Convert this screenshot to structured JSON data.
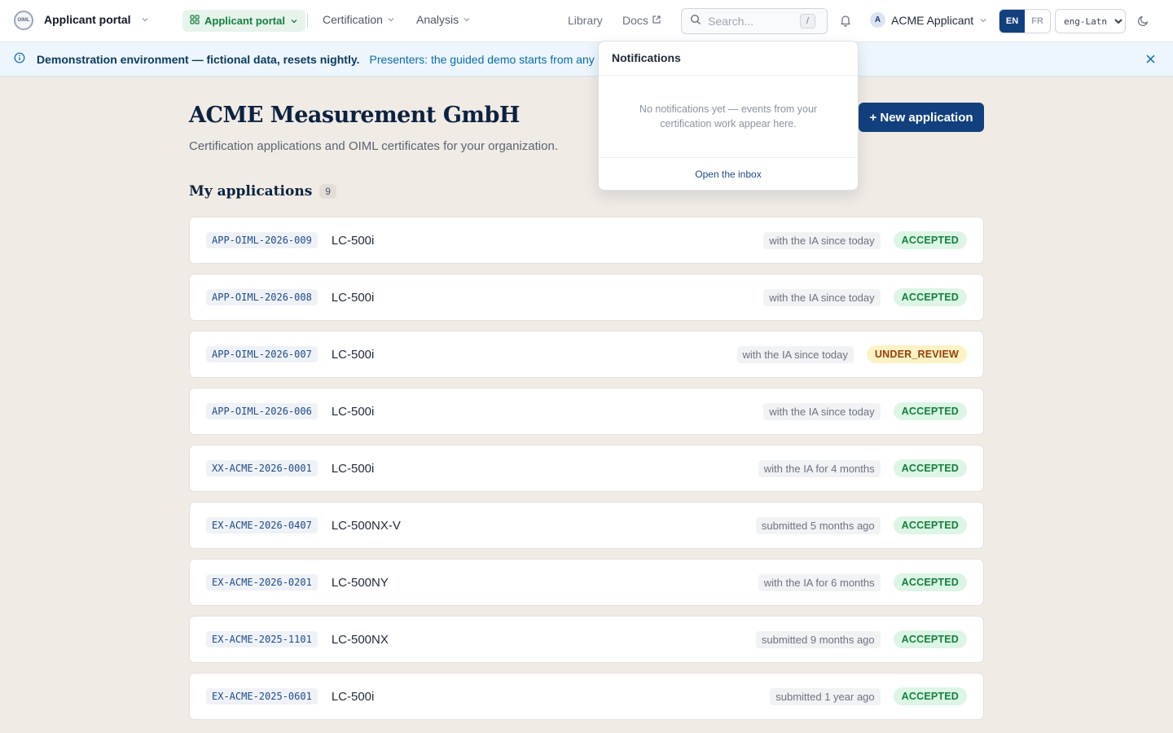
{
  "topbar": {
    "logo_text": "OIML",
    "app_name": "Applicant portal",
    "active_pill": "Applicant portal",
    "nav": [
      {
        "label": "Certification"
      },
      {
        "label": "Analysis"
      }
    ],
    "links": [
      {
        "label": "Library"
      },
      {
        "label": "Docs"
      }
    ],
    "search": {
      "placeholder": "Search...",
      "shortcut": "/"
    },
    "user": {
      "initial": "A",
      "name": "ACME Applicant"
    },
    "languages": [
      {
        "code": "EN",
        "active": true
      },
      {
        "code": "FR",
        "active": false
      }
    ],
    "script_select": "eng-Latn"
  },
  "banner": {
    "strong": "Demonstration environment — fictional data, resets nightly.",
    "link": "Presenters: the guided demo starts from any app p"
  },
  "page": {
    "title": "ACME Measurement GmbH",
    "subtitle": "Certification applications and OIML certificates for your organization.",
    "new_button": "+ New application",
    "section_title": "My applications",
    "section_count": "9"
  },
  "applications": [
    {
      "ref": "APP-OIML-2026-009",
      "model": "LC-500i",
      "since": "with the IA since today",
      "status": "ACCEPTED"
    },
    {
      "ref": "APP-OIML-2026-008",
      "model": "LC-500i",
      "since": "with the IA since today",
      "status": "ACCEPTED"
    },
    {
      "ref": "APP-OIML-2026-007",
      "model": "LC-500i",
      "since": "with the IA since today",
      "status": "UNDER_REVIEW"
    },
    {
      "ref": "APP-OIML-2026-006",
      "model": "LC-500i",
      "since": "with the IA since today",
      "status": "ACCEPTED"
    },
    {
      "ref": "XX-ACME-2026-0001",
      "model": "LC-500i",
      "since": "with the IA for 4 months",
      "status": "ACCEPTED"
    },
    {
      "ref": "EX-ACME-2026-0407",
      "model": "LC-500NX-V",
      "since": "submitted 5 months ago",
      "status": "ACCEPTED"
    },
    {
      "ref": "EX-ACME-2026-0201",
      "model": "LC-500NY",
      "since": "with the IA for 6 months",
      "status": "ACCEPTED"
    },
    {
      "ref": "EX-ACME-2025-1101",
      "model": "LC-500NX",
      "since": "submitted 9 months ago",
      "status": "ACCEPTED"
    },
    {
      "ref": "EX-ACME-2025-0601",
      "model": "LC-500i",
      "since": "submitted 1 year ago",
      "status": "ACCEPTED"
    }
  ],
  "notifications": {
    "title": "Notifications",
    "empty": "No notifications yet — events from your certification work appear here.",
    "footer": "Open the inbox"
  },
  "colors": {
    "accent": "#12407e",
    "accepted_bg": "#dcf5e4",
    "accepted_fg": "#15803d",
    "review_bg": "#fdf2c4",
    "review_fg": "#92400e",
    "page_bg": "#f0ebe5"
  }
}
